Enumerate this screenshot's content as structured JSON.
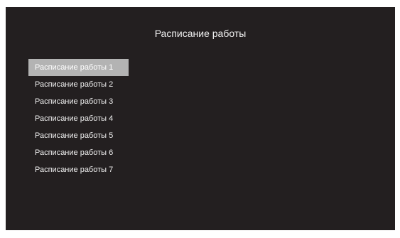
{
  "header": {
    "title": "Расписание работы"
  },
  "menu": {
    "items": [
      {
        "label": "Расписание работы 1",
        "selected": true
      },
      {
        "label": "Расписание работы 2",
        "selected": false
      },
      {
        "label": "Расписание работы 3",
        "selected": false
      },
      {
        "label": "Расписание работы 4",
        "selected": false
      },
      {
        "label": "Расписание работы 5",
        "selected": false
      },
      {
        "label": "Расписание работы 6",
        "selected": false
      },
      {
        "label": "Расписание работы 7",
        "selected": false
      }
    ]
  },
  "colors": {
    "background": "#231f20",
    "selection": "#b3b3b3",
    "text": "#ffffff"
  }
}
